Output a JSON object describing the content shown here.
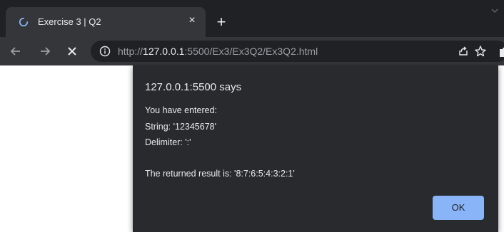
{
  "tab": {
    "title": "Exercise 3 | Q2",
    "close_label": "×"
  },
  "new_tab_label": "+",
  "toolbar": {
    "url_scheme": "http://",
    "url_host": "127.0.0.1",
    "url_rest": ":5500/Ex3/Ex3Q2/Ex3Q2.html"
  },
  "icons": {
    "spinner": "loading-spinner-icon",
    "back": "arrow-left-icon",
    "forward": "arrow-right-icon",
    "stop": "close-icon",
    "info": "info-icon",
    "share": "share-icon",
    "bookmark": "star-icon",
    "extensions": "puzzle-icon"
  },
  "colors": {
    "accent": "#8ab4f8",
    "tab_bar": "#202124",
    "toolbar": "#35363a",
    "dialog": "#292a2d"
  },
  "dialog": {
    "title": "127.0.0.1:5500 says",
    "lines": [
      "You have entered:",
      "String: '12345678'",
      "Delimiter: ':'",
      "The returned result is: '8:7:6:5:4:3:2:1'"
    ],
    "ok_label": "OK"
  }
}
